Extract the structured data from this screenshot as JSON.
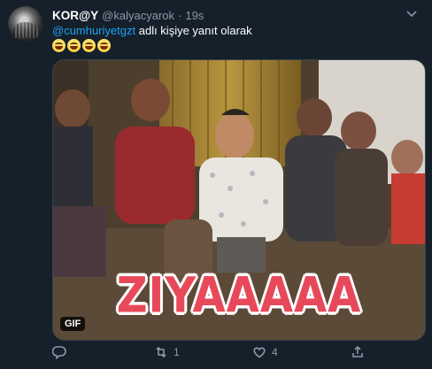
{
  "tweet": {
    "display_name": "KOR@Y",
    "handle": "@kalyacyarok",
    "separator": "·",
    "time": "19s",
    "reply_mention": "@cumhuriyetgzt",
    "reply_suffix": " adlı kişiye yanıt olarak",
    "emojis": [
      "😂",
      "😂",
      "😂",
      "😂"
    ],
    "media": {
      "caption": "ZIYAAAAA",
      "badge": "GIF"
    },
    "actions": {
      "reply_count": "",
      "retweet_count": "1",
      "like_count": "4"
    }
  },
  "colors": {
    "background": "#15202b",
    "accent": "#1da1f2",
    "muted": "#8899a6",
    "caption": "#e8495a"
  },
  "icons": [
    "chevron-down-icon",
    "reply-icon",
    "retweet-icon",
    "like-icon",
    "share-icon"
  ]
}
